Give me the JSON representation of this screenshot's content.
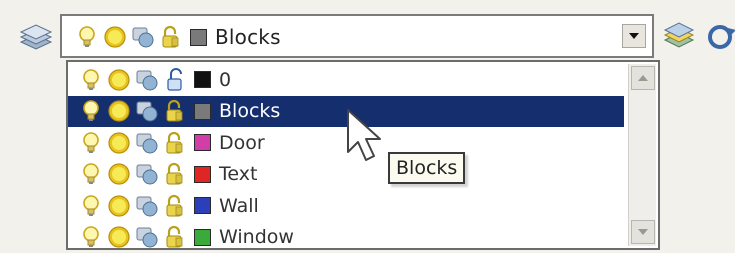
{
  "toolbar": {
    "layer_icon": "layers-stack-icon",
    "right_icons": [
      "layer-previous-icon",
      "layer-state-icon"
    ]
  },
  "layer_combo": {
    "selected_layer": "Blocks",
    "selected_color": "#7a7a7a",
    "icons": [
      "lightbulb-icon",
      "sun-icon",
      "freeze-viewport-icon",
      "lock-icon"
    ]
  },
  "dropdown": {
    "layers": [
      {
        "name": "0",
        "color": "#111111",
        "lock": "unlocked"
      },
      {
        "name": "Blocks",
        "color": "#7a7a7a",
        "lock": "locked",
        "selected": true
      },
      {
        "name": "Door",
        "color": "#d23ea8",
        "lock": "locked"
      },
      {
        "name": "Text",
        "color": "#e02525",
        "lock": "locked"
      },
      {
        "name": "Wall",
        "color": "#2b40b8",
        "lock": "locked"
      },
      {
        "name": "Window",
        "color": "#3aaa3a",
        "lock": "locked"
      }
    ]
  },
  "tooltip": {
    "text": "Blocks"
  },
  "colors": {
    "selection_bg": "#142e6e",
    "bulb_yellow": "#f2d43c",
    "sun_yellow": "#f5e12e"
  }
}
